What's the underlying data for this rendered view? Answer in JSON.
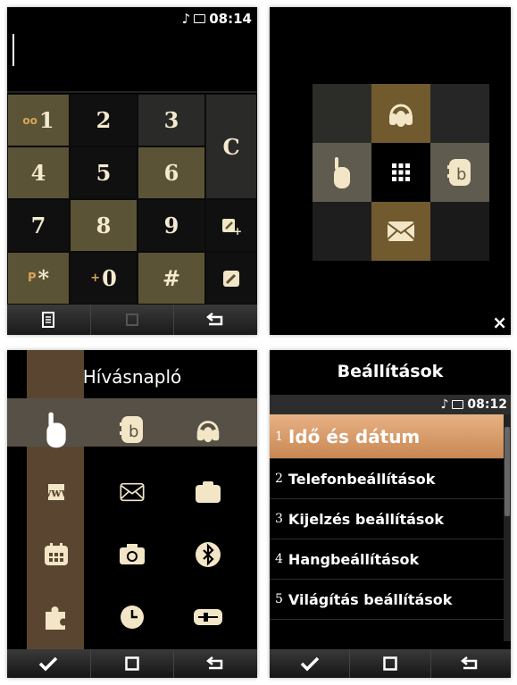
{
  "dialer": {
    "time": "08:14",
    "keys": [
      {
        "prefix": "oo",
        "label": "1"
      },
      {
        "label": "2"
      },
      {
        "label": "3"
      },
      {
        "label": "C"
      },
      {
        "label": "4"
      },
      {
        "label": "5"
      },
      {
        "label": "6"
      },
      {
        "label": "7"
      },
      {
        "label": "8"
      },
      {
        "label": "9"
      },
      {
        "prefix": "P",
        "label": "*"
      },
      {
        "prefix": "+",
        "label": "0"
      },
      {
        "label": "#"
      }
    ],
    "softkeys": [
      "menu-icon",
      "square-icon",
      "back-icon"
    ]
  },
  "quick_menu": {
    "items": [
      "headset-icon",
      "phone-icon",
      "keypad-icon",
      "contacts-icon",
      "message-icon"
    ],
    "close": "×"
  },
  "main_menu": {
    "title": "Hívásnapló",
    "icons": [
      "phone-icon",
      "contacts-icon",
      "headset-icon",
      "www-icon",
      "message-icon",
      "folder-icon",
      "calendar-icon",
      "camera-icon",
      "bluetooth-icon",
      "puzzle-icon",
      "clock-icon",
      "tools-icon"
    ],
    "www_label": "www",
    "softkeys": [
      "check-icon",
      "square-icon",
      "back-icon"
    ]
  },
  "settings": {
    "title": "Beállítások",
    "time": "08:12",
    "items": [
      {
        "num": "1",
        "label": "Idő és dátum"
      },
      {
        "num": "2",
        "label": "Telefonbeállítások"
      },
      {
        "num": "3",
        "label": "Kijelzés beállítások"
      },
      {
        "num": "4",
        "label": "Hangbeállítások"
      },
      {
        "num": "5",
        "label": "Világítás beállítások"
      }
    ],
    "softkeys": [
      "check-icon",
      "square-icon",
      "back-icon"
    ]
  },
  "colors": {
    "accent": "#8a6a3c",
    "olive": "#5a5336",
    "highlight": "#d9a06a"
  }
}
